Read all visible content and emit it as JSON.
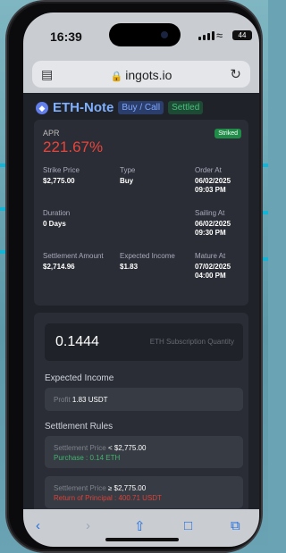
{
  "status_bar": {
    "time": "16:39",
    "battery": "44"
  },
  "browser": {
    "url": "ingots.io"
  },
  "header": {
    "title": "ETH-Note",
    "badge_type": "Buy / Call",
    "badge_status": "Settled"
  },
  "summary": {
    "apr_label": "APR",
    "apr_value": "221.67%",
    "status_badge": "Striked",
    "fields": [
      {
        "label": "Strike Price",
        "value": "$2,775.00"
      },
      {
        "label": "Type",
        "value": "Buy"
      },
      {
        "label": "Order At",
        "value": "06/02/2025\n09:03 PM"
      },
      {
        "label": "Duration",
        "value": "0 Days"
      },
      {
        "label": "Sailing At",
        "value": "06/02/2025\n09:30 PM"
      },
      {
        "label": "Settlement Amount",
        "value": "$2,714.96"
      },
      {
        "label": "Expected Income",
        "value": "$1.83"
      },
      {
        "label": "Mature At",
        "value": "07/02/2025\n04:00 PM"
      }
    ]
  },
  "subscription": {
    "quantity": "0.1444",
    "quantity_label": "ETH Subscription Quantity",
    "expected_income_title": "Expected Income",
    "profit_label": "Profit",
    "profit_value": "1.83 USDT",
    "rules_title": "Settlement Rules",
    "rule1": {
      "prefix": "Settlement Price",
      "cond": "< $2,775.00",
      "outcome": "Purchase : 0.14 ETH"
    },
    "rule2": {
      "prefix": "Settlement Price",
      "cond": "≥ $2,775.00",
      "outcome": "Return of Principal : 400.71 USDT"
    }
  },
  "colors": {
    "accent_blue": "#12b5d6",
    "apr_red": "#e8443b",
    "settled_green": "#45c17a"
  },
  "toolbar": {
    "icons": [
      "back-icon",
      "forward-icon",
      "share-icon",
      "bookmarks-icon",
      "tabs-icon"
    ]
  }
}
